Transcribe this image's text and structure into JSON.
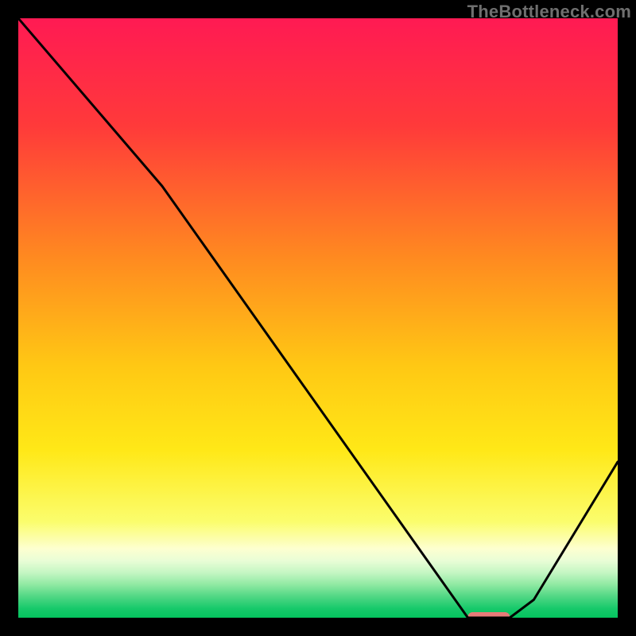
{
  "watermark": "TheBottleneck.com",
  "chart_data": {
    "type": "line",
    "title": "",
    "xlabel": "",
    "ylabel": "",
    "xlim": [
      0,
      100
    ],
    "ylim": [
      0,
      100
    ],
    "x": [
      0,
      24,
      75,
      82,
      86,
      100
    ],
    "values": [
      100,
      72,
      0,
      0,
      3,
      26
    ],
    "marker": {
      "x_start": 75,
      "x_end": 82,
      "y": 0
    },
    "gradient_stops": [
      {
        "offset": 0.0,
        "color": "#ff1a53"
      },
      {
        "offset": 0.18,
        "color": "#ff3a3a"
      },
      {
        "offset": 0.4,
        "color": "#ff8a20"
      },
      {
        "offset": 0.58,
        "color": "#ffc814"
      },
      {
        "offset": 0.72,
        "color": "#ffe817"
      },
      {
        "offset": 0.84,
        "color": "#fbfd6d"
      },
      {
        "offset": 0.885,
        "color": "#fdffd0"
      },
      {
        "offset": 0.905,
        "color": "#e9fdd6"
      },
      {
        "offset": 0.925,
        "color": "#c4f6c3"
      },
      {
        "offset": 0.945,
        "color": "#8fe9a2"
      },
      {
        "offset": 0.965,
        "color": "#4fd784"
      },
      {
        "offset": 0.985,
        "color": "#16c96a"
      },
      {
        "offset": 1.0,
        "color": "#05c45e"
      }
    ],
    "marker_color": "#e77b79",
    "line_color": "#000000",
    "grid": false
  }
}
